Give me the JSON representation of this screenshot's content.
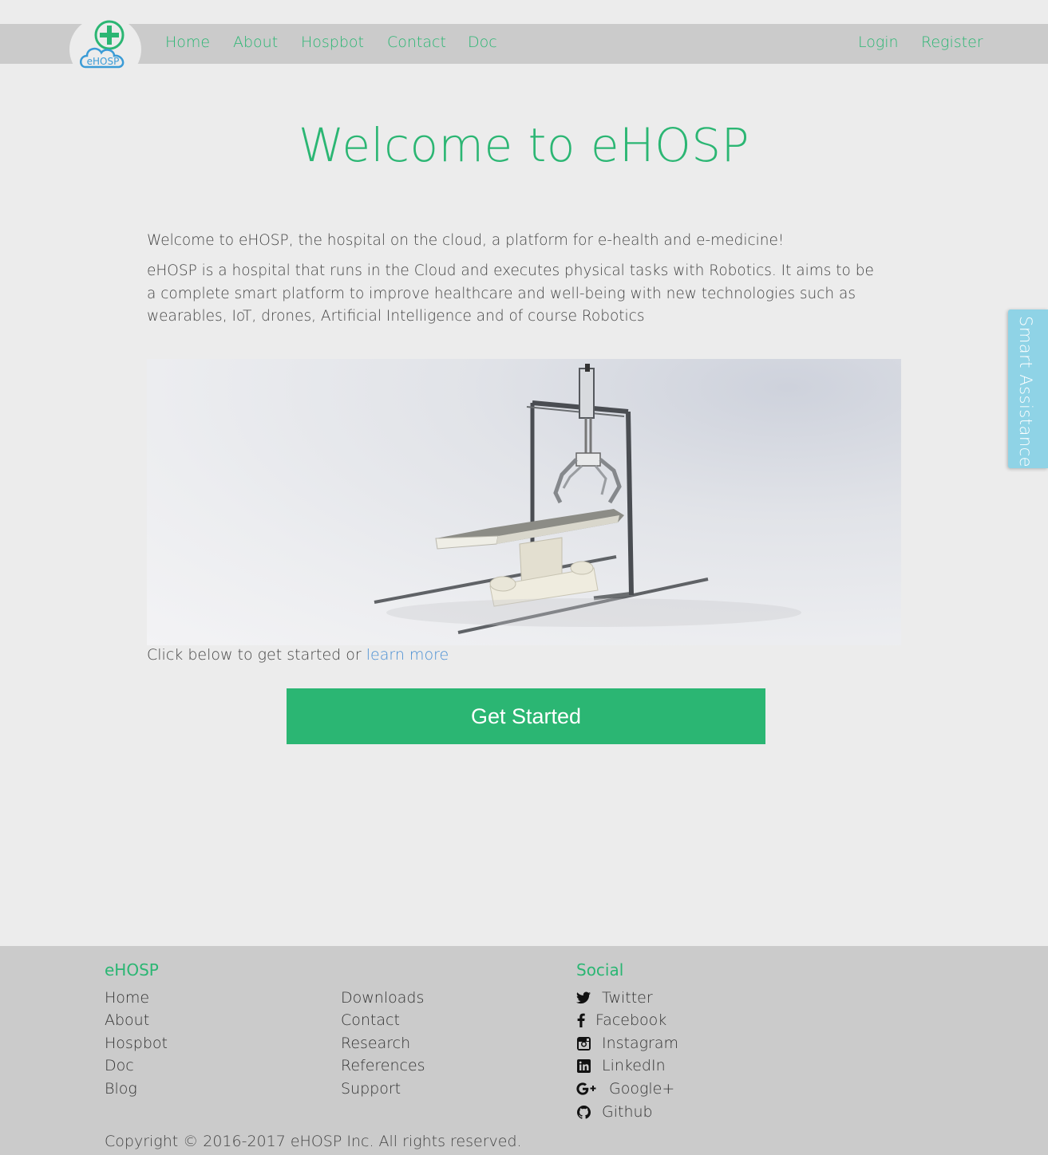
{
  "brand": {
    "logo_text": "eHOSP"
  },
  "nav": {
    "links": [
      "Home",
      "About",
      "Hospbot",
      "Contact",
      "Doc"
    ],
    "login": "Login",
    "register": "Register"
  },
  "main": {
    "title": "Welcome to eHOSP",
    "intro_1": "Welcome to eHOSP, the hospital on the cloud, a platform for e-health and e-medicine!",
    "intro_2": "eHOSP is a hospital that runs in the Cloud and executes physical tasks with Robotics. It aims to be a complete smart platform to improve healthcare and well-being with new technologies such as wearables, IoT, drones, Artificial Intelligence and of course Robotics",
    "cta_prefix": "Click below to get started or ",
    "learn_more": "learn more",
    "get_started": "Get Started"
  },
  "smart_assistance": "Smart Assistance",
  "footer": {
    "heading_left": "eHOSP",
    "heading_social": "Social",
    "col1": [
      "Home",
      "About",
      "Hospbot",
      "Doc",
      "Blog"
    ],
    "col2": [
      "Downloads",
      "Contact",
      "Research",
      "References",
      "Support"
    ],
    "social": [
      {
        "label": "Twitter",
        "icon": "twitter-icon"
      },
      {
        "label": "Facebook",
        "icon": "facebook-icon"
      },
      {
        "label": "Instagram",
        "icon": "instagram-icon"
      },
      {
        "label": "LinkedIn",
        "icon": "linkedin-icon"
      },
      {
        "label": "Google+",
        "icon": "google-plus-icon"
      },
      {
        "label": "Github",
        "icon": "github-icon"
      }
    ],
    "copyright": "Copyright © 2016-2017 eHOSP Inc. All rights reserved."
  },
  "colors": {
    "accent": "#2bb673",
    "link": "#4a8fd3",
    "assist": "#8fd3e6",
    "bar": "#cbcbcb",
    "page": "#ececec"
  }
}
